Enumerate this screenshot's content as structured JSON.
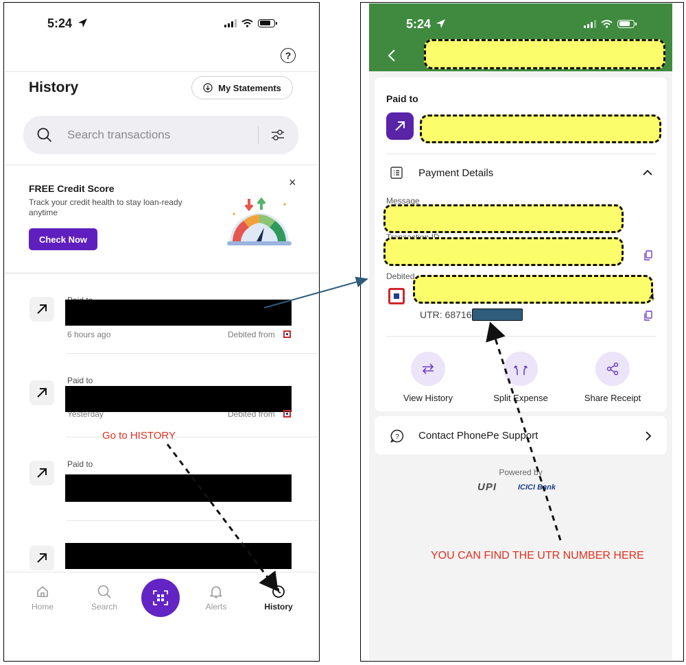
{
  "colors": {
    "accent_purple": "#5f1fbf",
    "header_green": "#3f8a3f",
    "highlight_yellow": "#fbfd6a",
    "annotation_red": "#e0301e",
    "arrow_blue": "#2e5c7a"
  },
  "left": {
    "status": {
      "time": "5:24"
    },
    "header": {
      "title": "History",
      "statements_label": "My Statements",
      "help_icon": "?"
    },
    "search": {
      "placeholder": "Search transactions"
    },
    "promo": {
      "title": "FREE Credit Score",
      "subtitle": "Track your credit health to stay loan-ready anytime",
      "cta": "Check Now",
      "close": "×"
    },
    "transactions": [
      {
        "label": "Paid to",
        "time": "6 hours ago",
        "debited": "Debited from"
      },
      {
        "label": "Paid to",
        "time": "Yesterday",
        "debited": "Debited from"
      },
      {
        "label": "Paid to",
        "time": "",
        "debited": ""
      },
      {
        "label": "",
        "time": "",
        "debited": ""
      }
    ],
    "nav": [
      {
        "label": "Home",
        "icon": "home-icon"
      },
      {
        "label": "Search",
        "icon": "search-icon"
      },
      {
        "label": "",
        "icon": "qr-scan-icon"
      },
      {
        "label": "Alerts",
        "icon": "bell-icon"
      },
      {
        "label": "History",
        "icon": "history-icon"
      }
    ],
    "annotation": "Go to HISTORY"
  },
  "right": {
    "status": {
      "time": "5:24"
    },
    "paid_to_label": "Paid to",
    "details": {
      "title": "Payment Details",
      "message_label": "Message",
      "txn_id_label": "Transaction ID",
      "debited_label": "Debited",
      "debited_tail": "4",
      "utr_prefix": "UTR: 68716"
    },
    "actions": [
      {
        "label": "View History",
        "icon": "swap-arrows-icon"
      },
      {
        "label": "Split Expense",
        "icon": "split-icon"
      },
      {
        "label": "Share Receipt",
        "icon": "share-icon"
      }
    ],
    "support": {
      "label": "Contact PhonePe Support"
    },
    "powered": {
      "label": "Powered by",
      "upi": "UPI",
      "bank": "ICICI Bank"
    },
    "annotation": "YOU CAN FIND THE UTR NUMBER HERE"
  }
}
